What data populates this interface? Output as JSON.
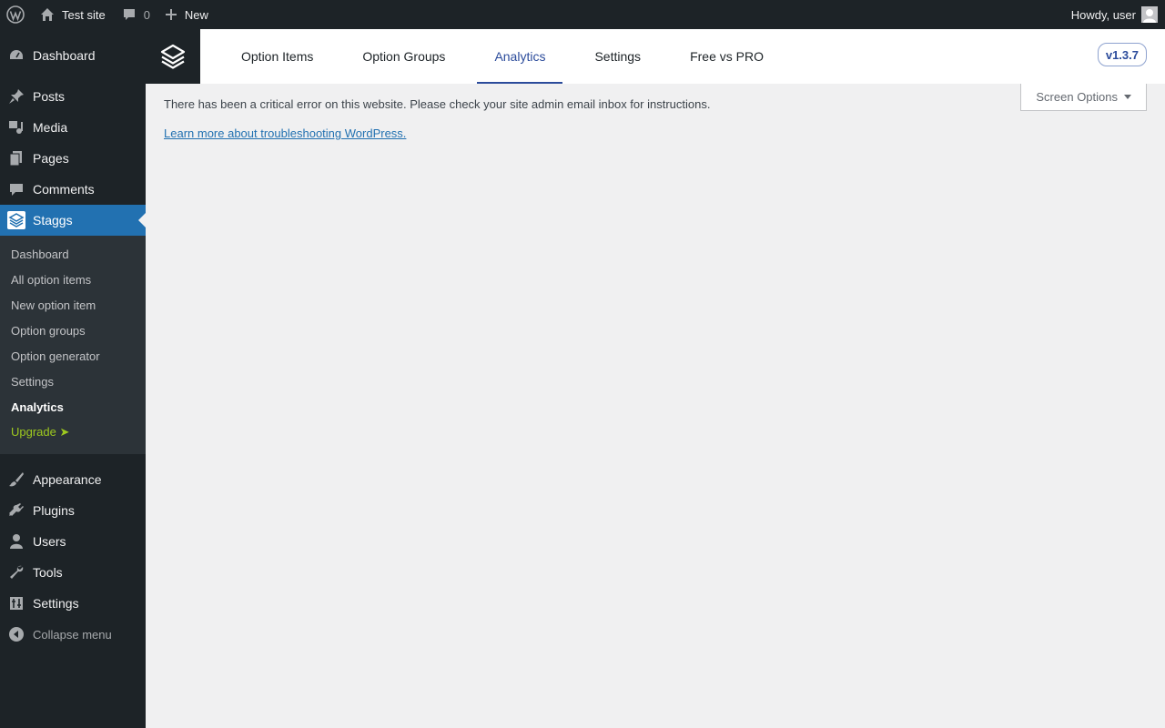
{
  "admin_bar": {
    "site_name": "Test site",
    "comments_count": "0",
    "new_label": "New",
    "greeting": "Howdy, user"
  },
  "sidebar": {
    "items_top": [
      {
        "label": "Dashboard",
        "icon": "dashboard-icon"
      },
      {
        "label": "Posts",
        "icon": "pin-icon"
      },
      {
        "label": "Media",
        "icon": "media-icon"
      },
      {
        "label": "Pages",
        "icon": "pages-icon"
      },
      {
        "label": "Comments",
        "icon": "comment-icon"
      },
      {
        "label": "Staggs",
        "icon": "staggs-icon"
      }
    ],
    "submenu": [
      {
        "label": "Dashboard"
      },
      {
        "label": "All option items"
      },
      {
        "label": "New option item"
      },
      {
        "label": "Option groups"
      },
      {
        "label": "Option generator"
      },
      {
        "label": "Settings"
      },
      {
        "label": "Analytics"
      },
      {
        "label": "Upgrade ➤"
      }
    ],
    "items_bottom": [
      {
        "label": "Appearance",
        "icon": "brush-icon"
      },
      {
        "label": "Plugins",
        "icon": "plugin-icon"
      },
      {
        "label": "Users",
        "icon": "user-icon"
      },
      {
        "label": "Tools",
        "icon": "wrench-icon"
      },
      {
        "label": "Settings",
        "icon": "settings-icon"
      }
    ],
    "collapse_label": "Collapse menu"
  },
  "plugin_header": {
    "tabs": [
      {
        "label": "Option Items"
      },
      {
        "label": "Option Groups"
      },
      {
        "label": "Analytics"
      },
      {
        "label": "Settings"
      },
      {
        "label": "Free vs PRO"
      }
    ],
    "version": "v1.3.7"
  },
  "content": {
    "screen_options_label": "Screen Options",
    "error_message": "There has been a critical error on this website. Please check your site admin email inbox for instructions.",
    "error_link": "Learn more about troubleshooting WordPress."
  },
  "colors": {
    "admin_dark": "#1d2327",
    "accent_blue": "#2271b1",
    "tab_active": "#2b4b9b",
    "upgrade_green": "#9ec91f"
  }
}
